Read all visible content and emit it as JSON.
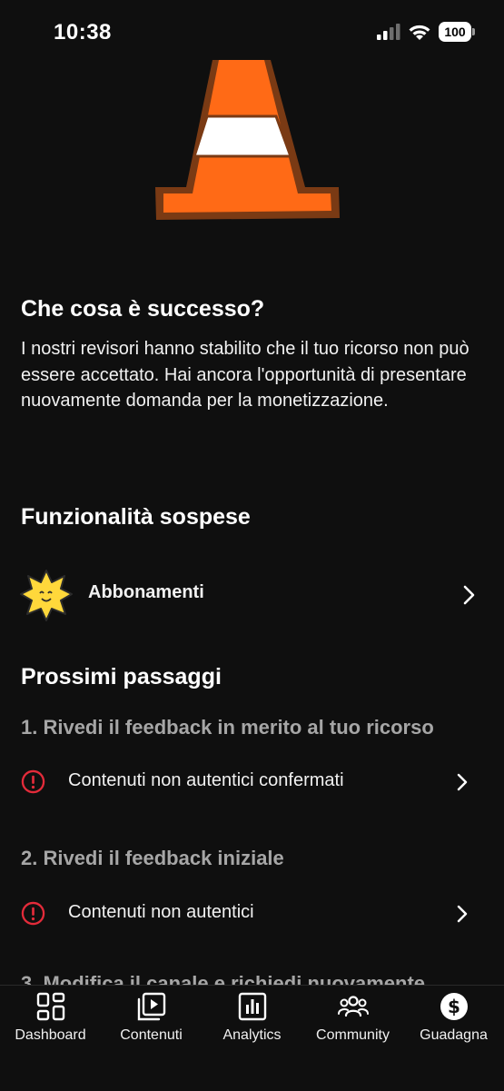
{
  "status_bar": {
    "time": "10:38",
    "battery": "100"
  },
  "colors": {
    "background": "#0f0f0f",
    "error_red": "#e32b3a",
    "muted_text": "#a6a6a6",
    "cone_orange": "#ff6a16",
    "cone_brown": "#7a3a14"
  },
  "what_happened": {
    "title": "Che cosa è successo?",
    "description": "I nostri revisori hanno stabilito che il tuo ricorso non può essere accettato. Hai ancora l'opportunità di presentare nuovamente domanda per la monetizzazione."
  },
  "suspended": {
    "title": "Funzionalità sospese",
    "items": [
      {
        "label": "Abbonamenti",
        "icon": "star-badge-icon"
      }
    ]
  },
  "next_steps": {
    "title": "Prossimi passaggi",
    "steps": [
      {
        "title": "1. Rivedi il feedback in merito al tuo ricorso",
        "item": {
          "label": "Contenuti non autentici confermati",
          "icon": "error-icon"
        }
      },
      {
        "title": "2. Rivedi il feedback iniziale",
        "item": {
          "label": "Contenuti non autentici",
          "icon": "error-icon"
        }
      },
      {
        "title": "3. Modifica il canale e richiedi nuovamente"
      }
    ]
  },
  "bottom_nav": {
    "items": [
      {
        "label": "Dashboard",
        "icon": "dashboard-icon"
      },
      {
        "label": "Contenuti",
        "icon": "content-icon"
      },
      {
        "label": "Analytics",
        "icon": "analytics-icon"
      },
      {
        "label": "Community",
        "icon": "community-icon"
      },
      {
        "label": "Guadagna",
        "icon": "dollar-icon"
      }
    ]
  }
}
